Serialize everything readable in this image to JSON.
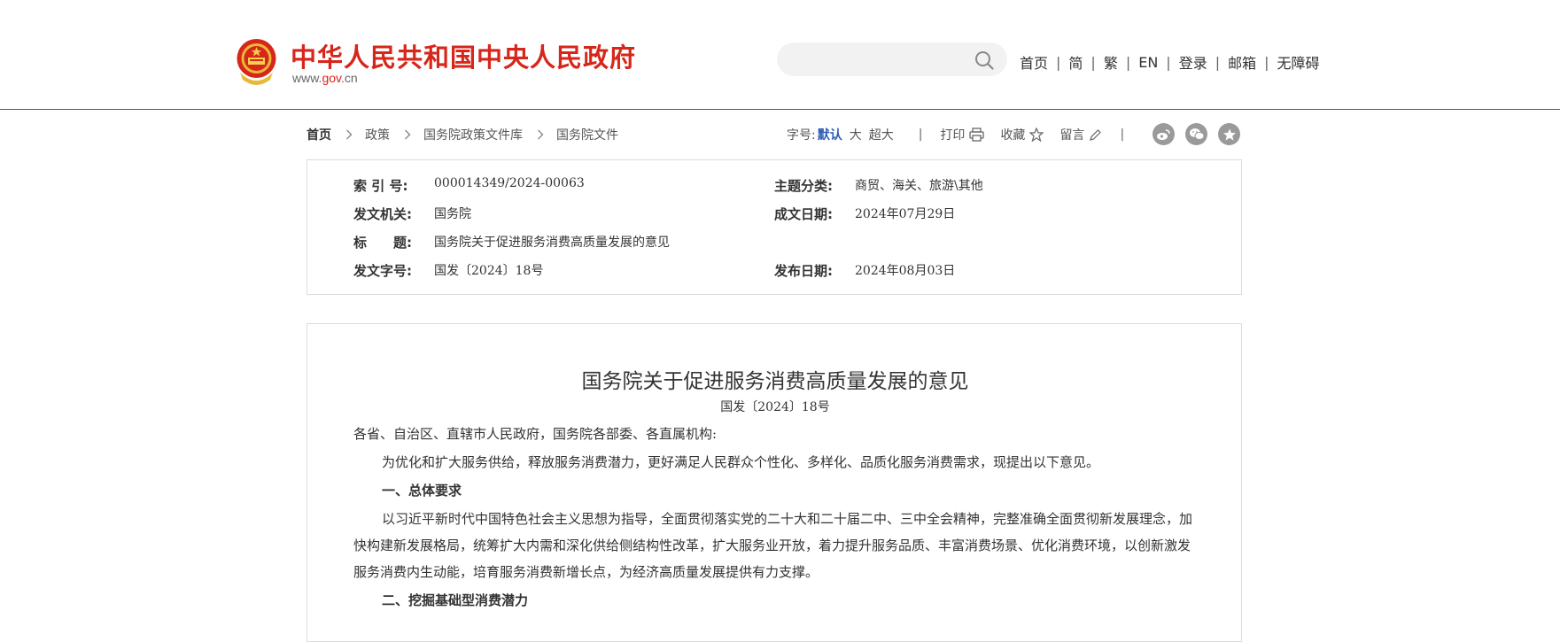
{
  "header": {
    "site_title": "中华人民共和国中央人民政府",
    "domain_prefix": "www.",
    "domain_gov": "gov",
    "domain_suffix": ".cn",
    "search_placeholder": "",
    "nav": [
      "首页",
      "简",
      "繁",
      "EN",
      "登录",
      "邮箱",
      "无障碍"
    ],
    "nav_separator": "|"
  },
  "breadcrumb": [
    "首页",
    "政策",
    "国务院政策文件库",
    "国务院文件"
  ],
  "tools": {
    "font_size_label": "字号:",
    "font_sizes": [
      "默认",
      "大",
      "超大"
    ],
    "separator": "|",
    "print": "打印",
    "favorite": "收藏",
    "comment": "留言"
  },
  "shares": [
    {
      "icon": "weibo-icon"
    },
    {
      "icon": "wechat-icon"
    },
    {
      "icon": "favorite-star-icon"
    }
  ],
  "meta": {
    "index_label": "索 引 号:",
    "index_value": "000014349/2024-00063",
    "topic_label": "主题分类:",
    "topic_value": "商贸、海关、旅游\\其他",
    "issuer_label": "发文机关:",
    "issuer_value": "国务院",
    "date_written_label": "成文日期:",
    "date_written_value": "2024年07月29日",
    "title_label": "标　　题:",
    "title_value": "国务院关于促进服务消费高质量发展的意见",
    "doc_number_label": "发文字号:",
    "doc_number_value": "国发〔2024〕18号",
    "publish_date_label": "发布日期:",
    "publish_date_value": "2024年08月03日"
  },
  "document": {
    "title": "国务院关于促进服务消费高质量发展的意见",
    "number": "国发〔2024〕18号",
    "salutation": "各省、自治区、直辖市人民政府，国务院各部委、各直属机构:",
    "intro": "为优化和扩大服务供给，释放服务消费潜力，更好满足人民群众个性化、多样化、品质化服务消费需求，现提出以下意见。",
    "heading1": "一、总体要求",
    "para1": "以习近平新时代中国特色社会主义思想为指导，全面贯彻落实党的二十大和二十届二中、三中全会精神，完整准确全面贯彻新发展理念，加快构建新发展格局，统筹扩大内需和深化供给侧结构性改革，扩大服务业开放，着力提升服务品质、丰富消费场景、优化消费环境，以创新激发服务消费内生动能，培育服务消费新增长点，为经济高质量发展提供有力支撑。",
    "heading2": "二、挖掘基础型消费潜力"
  },
  "colors": {
    "brand_red": "#d7261a",
    "link_blue": "#2f5bb3",
    "border": "#dcdcdc"
  }
}
